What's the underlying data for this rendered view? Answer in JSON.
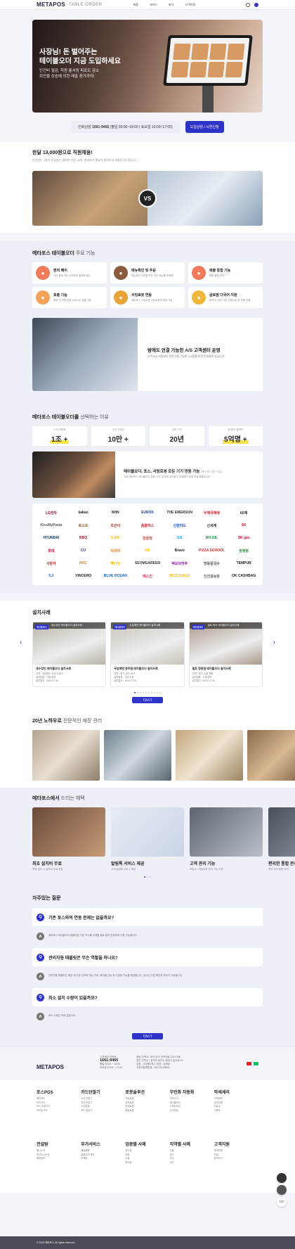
{
  "header": {
    "logo": "METAPOS",
    "logo_sub": "TABLE ORDER",
    "nav": [
      "제품",
      "서비스",
      "회사",
      "고객지원"
    ]
  },
  "hero": {
    "title_1": "사장님! 돈 벌어주는",
    "title_2": "테이블오더 지금 도입하세요",
    "sub_1": "인건비 절감, 직원 홀서빙 피로도 감소",
    "sub_2": "회전율 상승에 의한 매출 증가까지!"
  },
  "consult": {
    "label": "전화상담",
    "phone": "1661-9465",
    "hours": "(평일 09:00~18:00 | 토요일 10:00~17:00)",
    "button": "도입상담 / 시연신청"
  },
  "intro": {
    "title": "한달 13,000원으로 직원채용!",
    "subtitle": "인건비는 1명이 투입되는 설비만 가진, 교육, 관리비가 필요가 들어가고 비용은 실시됩니다.",
    "vs": "VS"
  },
  "features": {
    "brand": "메타포스 테이블오더",
    "title": "주요 기능",
    "items": [
      {
        "title": "편의 페이",
        "desc": "각자 결제 가능 간편하게 결제하세요",
        "color": "#f07a5a",
        "icon": "card-icon"
      },
      {
        "title": "메뉴확인 및 주문",
        "desc": "메뉴확인 사진을 보는 직관 메뉴를 판매해",
        "color": "#8c5a3c",
        "icon": "menu-icon"
      },
      {
        "title": "매출 통합 기능",
        "desc": "매출 통합 관리",
        "color": "#f07a5a",
        "icon": "chart-icon"
      },
      {
        "title": "호출 기능",
        "desc": "매장 내 직원 호출 서비스로 호출 가능",
        "color": "#f5a25a",
        "icon": "bell-icon"
      },
      {
        "title": "서빙로봇 연동",
        "desc": "메타포스 서빙로봇 서빙로봇과 연동 가능",
        "color": "#e8a33a",
        "icon": "robot-icon"
      },
      {
        "title": "글로벌 다국어 지원",
        "desc": "한국어, 외국 기본 지원으로 한 번에 연결",
        "color": "#f0b63a",
        "icon": "globe-icon"
      }
    ]
  },
  "as_service": {
    "title": "밤에도 연결 가능한 A/S 고객센터 운영",
    "desc": "고객 A/S 지원센터 운영 연중 가능한 A/S밤을 미정 운영중에 있습니다."
  },
  "reasons": {
    "brand": "메타포스 테이블오더를",
    "title": "선택하는 이유",
    "stats": [
      {
        "label": "누적 판매액",
        "value": "1조 +",
        "highlight": true
      },
      {
        "label": "누적 가맹점",
        "value": "10만 +",
        "highlight": false
      },
      {
        "label": "업력 기간",
        "value": "20년",
        "highlight": false
      },
      {
        "label": "월 평균 결제액",
        "value": "5억명 +",
        "highlight": true
      }
    ]
  },
  "video": {
    "title": "테이블오더, 포스, 서빙로봇 모든 기기 연동 가능",
    "title_note": "(포스와 기존 기능)",
    "desc": "기존 메타포스 테이블오더 연동 기기, 분야에 상관없이 관계없이 업계 최적 제품입니다."
  },
  "partners": [
    {
      "name": "LG전자",
      "color": "#a50034"
    },
    {
      "name": "kakao",
      "color": "#222222"
    },
    {
      "name": "NHN",
      "color": "#222222"
    },
    {
      "name": "EUROX",
      "color": "#1b3a8c"
    },
    {
      "name": "THE EMERSON",
      "color": "#333333"
    },
    {
      "name": "우체국택배",
      "color": "#d31e25"
    },
    {
      "name": "60계",
      "color": "#222222"
    },
    {
      "name": "KissMyPasta",
      "color": "#555555"
    },
    {
      "name": "토스트",
      "color": "#8a5a2b"
    },
    {
      "name": "뜨끈이",
      "color": "#c0392b"
    },
    {
      "name": "홈플러스",
      "color": "#d01c2a"
    },
    {
      "name": "신한카드",
      "color": "#0046ff"
    },
    {
      "name": "신세계",
      "color": "#333333"
    },
    {
      "name": "SK",
      "color": "#ea002c"
    },
    {
      "name": "HYUNDAI",
      "color": "#002c5f"
    },
    {
      "name": "BBQ",
      "color": "#e60012"
    },
    {
      "name": "S-OIL",
      "color": "#f4b600"
    },
    {
      "name": "임창정",
      "color": "#c0392b"
    },
    {
      "name": "GS",
      "color": "#00a0e9"
    },
    {
      "name": "NH-OIL",
      "color": "#00963f"
    },
    {
      "name": "SK gas",
      "color": "#ea002c"
    },
    {
      "name": "롯데",
      "color": "#e4002b"
    },
    {
      "name": "CU",
      "color": "#652d90"
    },
    {
      "name": "빅마마",
      "color": "#e67e22"
    },
    {
      "name": "KB",
      "color": "#ffbc00"
    },
    {
      "name": "Bravo",
      "color": "#222222"
    },
    {
      "name": "PIZZA SCHOOL",
      "color": "#d32f2f"
    },
    {
      "name": "청정원",
      "color": "#2e7d32"
    },
    {
      "name": "사랑각",
      "color": "#c62828"
    },
    {
      "name": "BHC",
      "color": "#f57c00"
    },
    {
      "name": "빽다방",
      "color": "#f9c800"
    },
    {
      "name": "SEOMGAREEN",
      "color": "#333333"
    },
    {
      "name": "떡보의하루",
      "color": "#8e24aa"
    },
    {
      "name": "명동칼국수",
      "color": "#555555"
    },
    {
      "name": "TEMPUR",
      "color": "#1a1a1a"
    },
    {
      "name": "5.3",
      "color": "#1565c0"
    },
    {
      "name": "VINCERO",
      "color": "#222222"
    },
    {
      "name": "BLUE OCEAN",
      "color": "#1565c0"
    },
    {
      "name": "베스킨",
      "color": "#e91e63"
    },
    {
      "name": "MCDONALD",
      "color": "#ffbc0d"
    },
    {
      "name": "신선설농탕",
      "color": "#666666"
    },
    {
      "name": "OK CASHBAG",
      "color": "#222222"
    }
  ],
  "cases": {
    "title": "설치사례",
    "tag": "메타플레이",
    "items": [
      {
        "caption": "생수장인 테이블오더 설치사례",
        "name": "생수장인 테이블오더 설치사례",
        "info_1": "지역 : 경남제도, 부산 수영구",
        "info_2": "설치업종 : 식당/주점",
        "info_3": "설치일자 : 2024-07-18",
        "color": "#b9b4a6"
      },
      {
        "caption": "두암예천 테이블오더 설치사례",
        "name": "두암예천 광주점 테이블오더 설치사례",
        "info_1": "지역 : 경기, 광주 북구",
        "info_2": "설치업종 : 식당/주점",
        "info_3": "설치일자 : 2024-07-05",
        "color": "#c9c3b8"
      },
      {
        "caption": "빌트 비어 테이블오더 설치사례",
        "name": "빌트 정왕점 테이블오더 설치사례",
        "info_1": "지역 : 경기, 시흥 정왕",
        "info_2": "설치업종 : 주점/호프",
        "info_3": "설치일자 : 2023-12-26",
        "color": "#a8998a"
      }
    ],
    "more": "더보기"
  },
  "gallery": {
    "title": "20년 노하우로",
    "title_lite": "전문적인 매장 관리"
  },
  "benefits": {
    "brand": "메타포스에서",
    "title": "드리는 혜택",
    "items": [
      {
        "title": "최초 설치비 무료",
        "desc": "처음 설치 시 설치비 무료 지원"
      },
      {
        "title": "알림톡 서비스 제공",
        "desc": "고객 알림톡 서비스 제공"
      },
      {
        "title": "고객 관리 기능",
        "desc": "적립금 / 마일리지 관리 기능 지원"
      },
      {
        "title": "편리한 통합 관리",
        "desc": "여러 매장 통합 관리"
      }
    ]
  },
  "faq": {
    "title": "자주있는 질문",
    "items": [
      {
        "q": "기존 포스와의 연동 문제는 없을까요?",
        "a": "메타포스 테이블오더 태블릿은 기존 포스를 교체할 필요 없이 연동하여 사용 가능합니다."
      },
      {
        "q": "관리자용 태블릿은 무슨 역할을 하나요?",
        "a": "관리자용 태블릿은 매장 내 주문 관리와 메뉴 관리, 테이블 관리 등 다양한 기능을 제공합니다. 실시간 주문 확인과 처리가 가능합니다."
      },
      {
        "q": "최소 설치 수량이 있을까요?",
        "a": "최소 수량은 따로 없습니다."
      }
    ],
    "more": "더보기"
  },
  "company": {
    "logo": "METAPOS",
    "cs_label": "고객센터 연락처",
    "cs_phone": "1661-9465",
    "cs_hours_1": "평일 09:00 ~ 18:00",
    "cs_hours_2": "토요일 10:00 ~ 17:00",
    "address_1": "경남 지역사 : 부산 남구 전포대로 133 12층",
    "address_2": "경기 지역사 : 경기도 부천시 원미구 길주로 91",
    "address_3": "상호 : (주)메타포스  대표 : 김재균",
    "address_4": "사업자등록번호 : 000-00-00000"
  },
  "footer_nav": [
    {
      "head": "포스POS",
      "items": [
        "메타포스",
        "터치 포스",
        "포스 주변기기",
        "모바일 포스"
      ]
    },
    {
      "head": "카드단말기",
      "items": [
        "무선 단말기",
        "유선 단말기",
        "무선결제",
        "카드 단말기"
      ]
    },
    {
      "head": "로봇솔루션",
      "items": [
        "서빙로봇",
        "방역로봇",
        "안내로봇",
        "배달로봇"
      ]
    },
    {
      "head": "무인화 자동화",
      "items": [
        "키오스크",
        "테이블오더",
        "스마트오더",
        "무인매장"
      ]
    },
    {
      "head": "막세세리",
      "items": [
        "고객센터",
        "공지사항",
        "자료실",
        "이벤트"
      ]
    },
    {
      "head": "전설탐",
      "items": [
        "회사소개",
        "찾아오시는길",
        "채용정보"
      ]
    },
    {
      "head": "부가서비스",
      "items": [
        "배달대행",
        "홈페이지 제작",
        "마케팅"
      ]
    },
    {
      "head": "업종별 사례",
      "items": [
        "음식점",
        "카페",
        "주점",
        "편의점"
      ]
    },
    {
      "head": "지역별 사례",
      "items": [
        "서울",
        "경기",
        "부산",
        "대구"
      ]
    },
    {
      "head": "고객지원",
      "items": [
        "원격지원",
        "FAQ",
        "문의하기"
      ]
    }
  ],
  "copyright": "© 2024 메타포스 All rights reserved.",
  "floating": {
    "top": "TOP"
  },
  "colors": {
    "accent": "#2f34c9",
    "accent_text": "#3437c7",
    "highlight": "#ffe34d"
  }
}
